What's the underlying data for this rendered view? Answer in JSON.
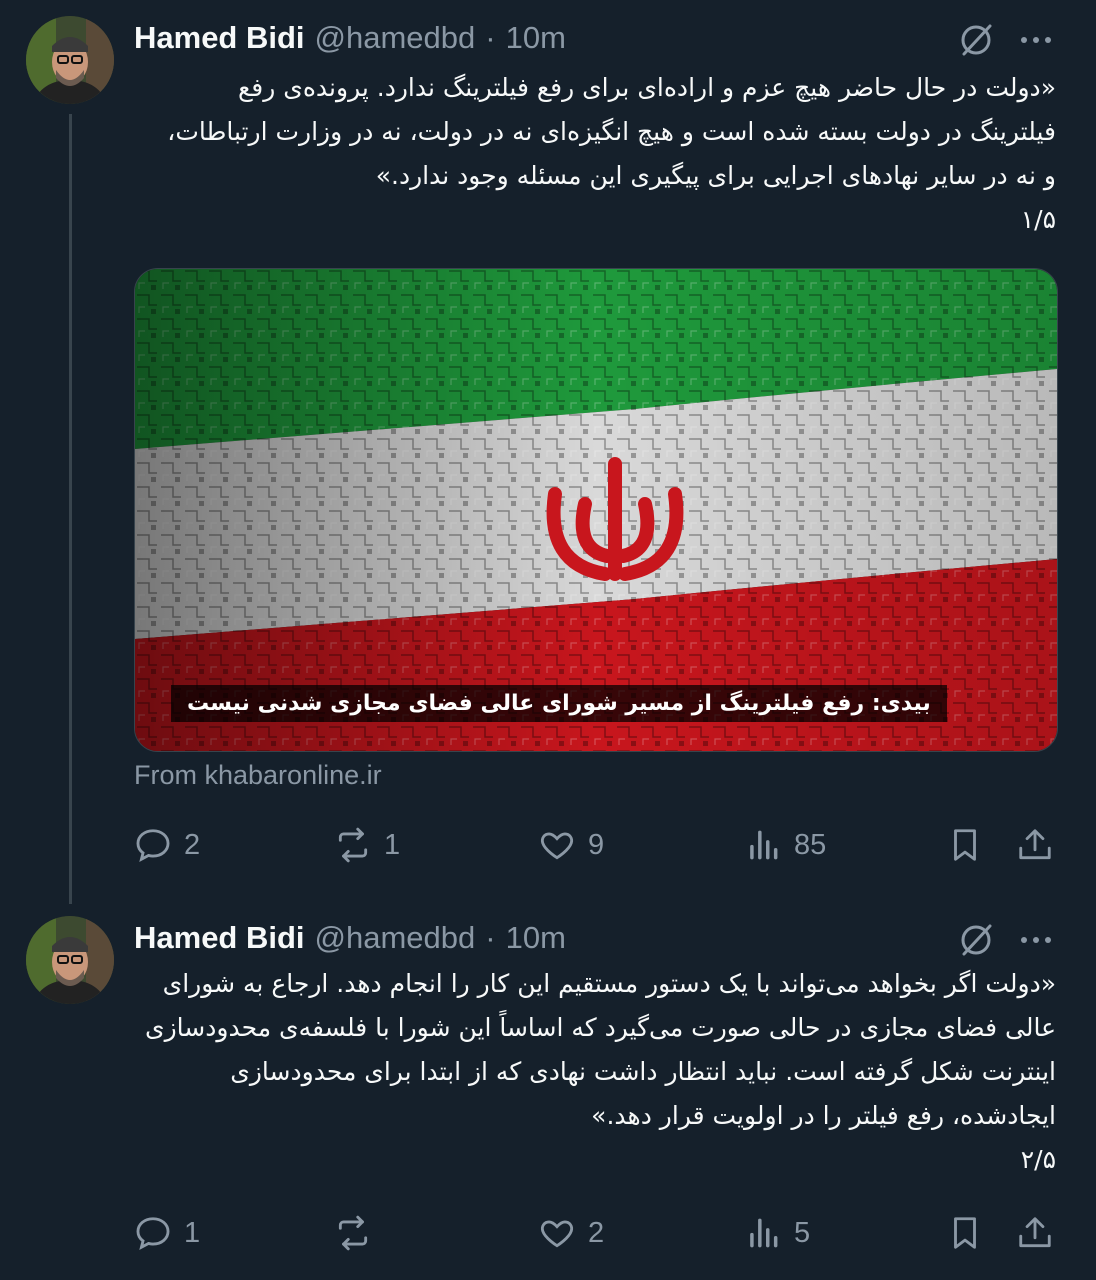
{
  "tweets": [
    {
      "name": "Hamed Bidi",
      "handle": "@hamedbd",
      "separator": "·",
      "time": "10m",
      "text_lines": [
        "«دولت در حال حاضر هیچ عزم و اراده‌ای برای رفع فیلترینگ ندارد. پرونده‌ی رفع",
        "فیلترینگ در دولت بسته شده است و هیچ انگیزه‌ای نه در دولت، نه در وزارت ارتباطات،",
        "و نه در سایر نهادهای اجرایی برای پیگیری این مسئله وجود ندارد.»",
        "۱/۵"
      ],
      "card": {
        "caption": "بیدی: رفع فیلترینگ از مسیر شورای عالی فضای مجازی شدنی نیست",
        "source": "From khabaronline.ir",
        "flag_colors": {
          "green": "#1f9a3c",
          "white": "#d9d9d9",
          "red": "#c8161d"
        }
      },
      "actions": {
        "replies": "2",
        "reposts": "1",
        "likes": "9",
        "views": "85"
      }
    },
    {
      "name": "Hamed Bidi",
      "handle": "@hamedbd",
      "separator": "·",
      "time": "10m",
      "text_lines": [
        "«دولت اگر بخواهد می‌تواند با یک دستور مستقیم این کار را انجام دهد. ارجاع به شورای",
        "عالی فضای مجازی در حالی صورت می‌گیرد که اساساً این شورا با فلسفه‌ی محدودسازی",
        "اینترنت شکل گرفته است. نباید انتظار داشت نهادی که از ابتدا برای محدودسازی",
        "ایجادشده، رفع فیلتر را در اولویت قرار دهد.»",
        "۲/۵"
      ],
      "actions": {
        "replies": "1",
        "reposts": "",
        "likes": "2",
        "views": "5"
      }
    }
  ],
  "icons": {
    "reply": "reply-icon",
    "repost": "repost-icon",
    "like": "heart-icon",
    "views": "views-icon",
    "bookmark": "bookmark-icon",
    "share": "share-icon",
    "grok": "grok-icon",
    "more": "more-icon"
  },
  "colors": {
    "background": "#15202b",
    "text": "#f7f9f9",
    "muted": "#8b98a5",
    "line": "#38444d"
  }
}
